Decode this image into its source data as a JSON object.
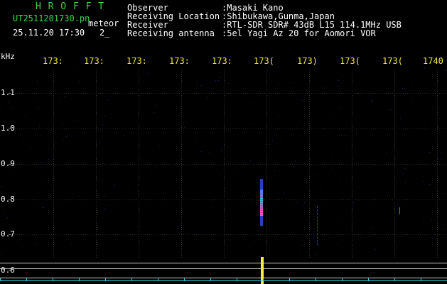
{
  "header": {
    "brand": "H R O F F T",
    "filename": "UT2511201730.pn",
    "filename_suffix": "meteor",
    "datetime": "25.11.20 17:30",
    "counter": "2_",
    "fields": [
      {
        "label": "Observer",
        "value": ":Masaki Kano"
      },
      {
        "label": "Receiving Location",
        "value": ":Shibukawa,Gunma,Japan"
      },
      {
        "label": "Receiver",
        "value": ":RTL-SDR SDR# 43dB L15 114.1MHz USB"
      },
      {
        "label": "Receiving antenna",
        "value": ":5el Yagi Az 20 for Aomori VOR"
      }
    ]
  },
  "axis": {
    "unit_label": "kHz",
    "freq_ticks": [
      "173:",
      "173:",
      "173:",
      "173:",
      "173:",
      "173(",
      "173)",
      "173(",
      "173(",
      "1740"
    ],
    "left_ticks": [
      "1.1",
      "1.0",
      "0.9",
      "0.8",
      "0.7",
      "0.6"
    ]
  },
  "colors": {
    "background": "#000000",
    "header_green": "#35d84a",
    "header_white": "#ffffff",
    "freq_yellow": "#f2e83a",
    "meteor_magenta": "#e23ca8",
    "meteor_cyan": "#2ec7d8",
    "level_yellow": "#f5f03a"
  }
}
